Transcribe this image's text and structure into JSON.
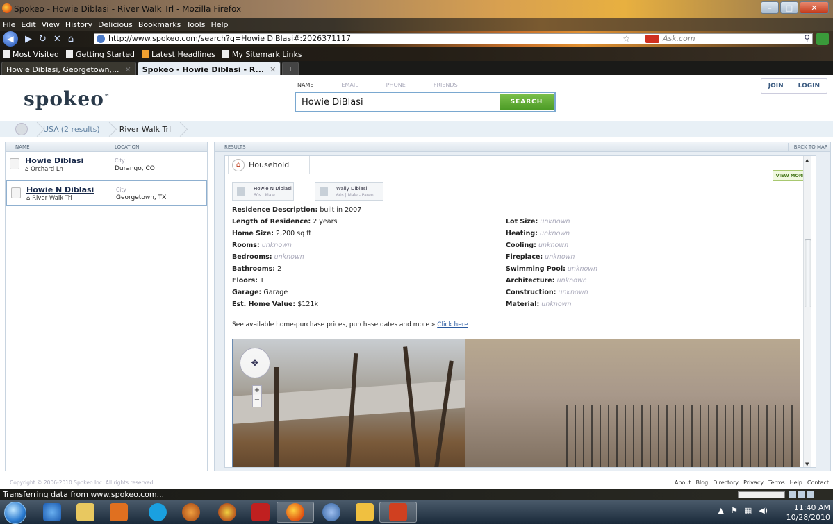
{
  "window": {
    "title": "Spokeo - Howie Diblasi - River Walk Trl - Mozilla Firefox"
  },
  "menu": [
    "File",
    "Edit",
    "View",
    "History",
    "Delicious",
    "Bookmarks",
    "Tools",
    "Help"
  ],
  "nav": {
    "url": "http://www.spokeo.com/search?q=Howie DiBlasi#:2026371117",
    "search_placeholder": "Ask.com"
  },
  "bookmarks": [
    "Most Visited",
    "Getting Started",
    "Latest Headlines",
    "My Sitemark Links"
  ],
  "tabs": [
    {
      "label": "Howie Diblasi, Georgetown,...",
      "active": false
    },
    {
      "label": "Spokeo - Howie Diblasi - R...",
      "active": true
    }
  ],
  "header": {
    "logo": "spokeo",
    "logo_tm": "™",
    "search_tabs": [
      "NAME",
      "EMAIL",
      "PHONE",
      "FRIENDS"
    ],
    "search_value": "Howie DiBlasi",
    "search_button": "SEARCH",
    "join": "JOIN",
    "login": "LOGIN"
  },
  "breadcrumb": {
    "country": "USA",
    "count": "(2 results)",
    "current": "River Walk Trl"
  },
  "left_panel": {
    "col_name": "NAME",
    "col_location": "LOCATION",
    "results": [
      {
        "name": "Howie Diblasi",
        "street": "Orchard Ln",
        "loc_label": "City",
        "city": "Durango, CO",
        "selected": false
      },
      {
        "name": "Howie N Diblasi",
        "street": "River Walk Trl",
        "loc_label": "City",
        "city": "Georgetown, TX",
        "selected": true
      }
    ]
  },
  "right_panel": {
    "header": "RESULTS",
    "back_to_map": "BACK TO MAP",
    "tab": "Household",
    "view_more": "VIEW MORE",
    "people": [
      {
        "name": "Howie N Diblasi",
        "detail": "60s | Male"
      },
      {
        "name": "Wally Diblasi",
        "detail": "60s | Male - Parent"
      }
    ],
    "left_fields": [
      {
        "label": "Residence Description:",
        "value": "built in 2007",
        "unknown": false
      },
      {
        "label": "Length of Residence:",
        "value": "2 years",
        "unknown": false
      },
      {
        "label": "Home Size:",
        "value": "2,200 sq ft",
        "unknown": false
      },
      {
        "label": "Rooms:",
        "value": "unknown",
        "unknown": true
      },
      {
        "label": "Bedrooms:",
        "value": "unknown",
        "unknown": true
      },
      {
        "label": "Bathrooms:",
        "value": "2",
        "unknown": false
      },
      {
        "label": "Floors:",
        "value": "1",
        "unknown": false
      },
      {
        "label": "Garage:",
        "value": "Garage",
        "unknown": false
      },
      {
        "label": "Est. Home Value:",
        "value": "$121k",
        "unknown": false
      }
    ],
    "right_fields": [
      {
        "label": "Lot Size:",
        "value": "unknown"
      },
      {
        "label": "Heating:",
        "value": "unknown"
      },
      {
        "label": "Cooling:",
        "value": "unknown"
      },
      {
        "label": "Fireplace:",
        "value": "unknown"
      },
      {
        "label": "Swimming Pool:",
        "value": "unknown"
      },
      {
        "label": "Architecture:",
        "value": "unknown"
      },
      {
        "label": "Construction:",
        "value": "unknown"
      },
      {
        "label": "Material:",
        "value": "unknown"
      }
    ],
    "see_text": "See available home-purchase prices, purchase dates and more »",
    "see_link": "Click here"
  },
  "footer": {
    "copyright": "Copyright © 2006-2010 Spokeo Inc. All rights reserved",
    "links": [
      "About",
      "Blog",
      "Directory",
      "Privacy",
      "Terms",
      "Help",
      "Contact"
    ]
  },
  "status": "Transferring data from www.spokeo.com...",
  "taskbar": {
    "time": "11:40 AM",
    "date": "10/28/2010"
  }
}
